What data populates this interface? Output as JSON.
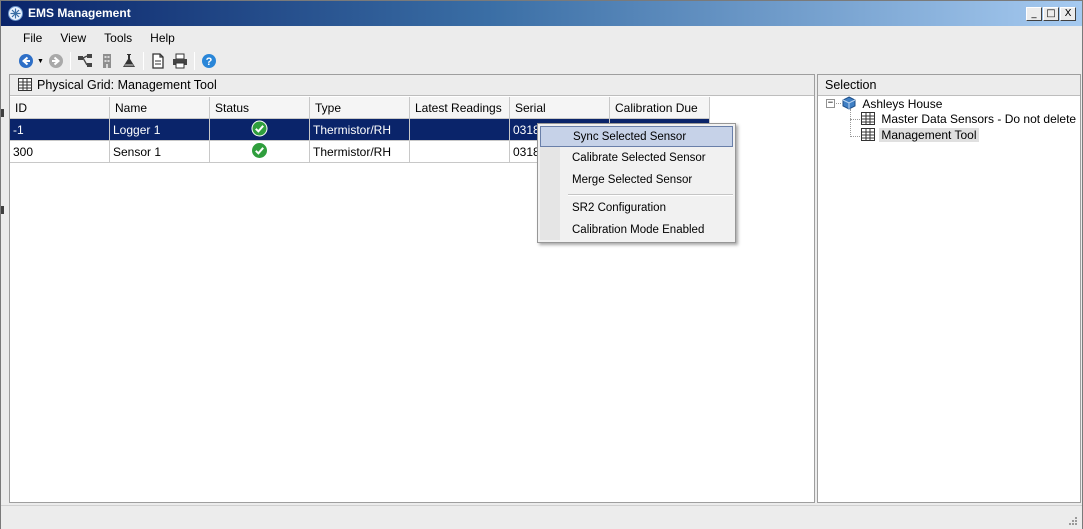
{
  "window": {
    "title": "EMS Management",
    "controls": {
      "minimize": "_",
      "maximize": "□",
      "close": "X"
    }
  },
  "menu": [
    {
      "label": "File",
      "icon": "none"
    },
    {
      "label": "View",
      "icon": "none"
    },
    {
      "label": "Tools",
      "icon": "none"
    },
    {
      "label": "Help",
      "icon": "none"
    }
  ],
  "toolbar": {
    "icons": [
      "back-icon",
      "dropdown-icon",
      "forward-icon",
      "network-icon",
      "building-icon",
      "flask-icon",
      "document-icon",
      "print-icon",
      "help-icon"
    ]
  },
  "left_panel": {
    "header": "Physical Grid:  Management Tool",
    "columns": [
      "ID",
      "Name",
      "Status",
      "Type",
      "Latest Readings",
      "Serial",
      "Calibration Due"
    ],
    "rows": [
      {
        "id": "-1",
        "name": "Logger 1",
        "status": "ok",
        "type": "Thermistor/RH",
        "latest": "",
        "serial": "0318",
        "calibration_due": "",
        "selected": true
      },
      {
        "id": "300",
        "name": "Sensor 1",
        "status": "ok",
        "type": "Thermistor/RH",
        "latest": "",
        "serial": "0318",
        "calibration_due": "",
        "selected": false
      }
    ]
  },
  "context_menu": {
    "items": [
      {
        "label": "Sync Selected Sensor",
        "highlighted": true
      },
      {
        "label": "Calibrate Selected Sensor",
        "highlighted": false
      },
      {
        "label": "Merge Selected Sensor",
        "highlighted": false
      },
      {
        "label": "SR2 Configuration",
        "highlighted": false
      },
      {
        "label": "Calibration Mode Enabled",
        "highlighted": false
      }
    ]
  },
  "right_panel": {
    "header": "Selection",
    "tree": {
      "root": {
        "label": "Ashleys House",
        "expanded": true,
        "expander": "−"
      },
      "children": [
        {
          "label": "Master Data Sensors - Do not delete",
          "selected": false
        },
        {
          "label": "Management Tool",
          "selected": true
        }
      ]
    }
  },
  "colors": {
    "selection_bg": "#0a246a",
    "titlebar_start": "#0a246a",
    "titlebar_end": "#a6caf0",
    "status_ok": "#2f9e3d",
    "menu_hover": "#c6d2e8"
  }
}
